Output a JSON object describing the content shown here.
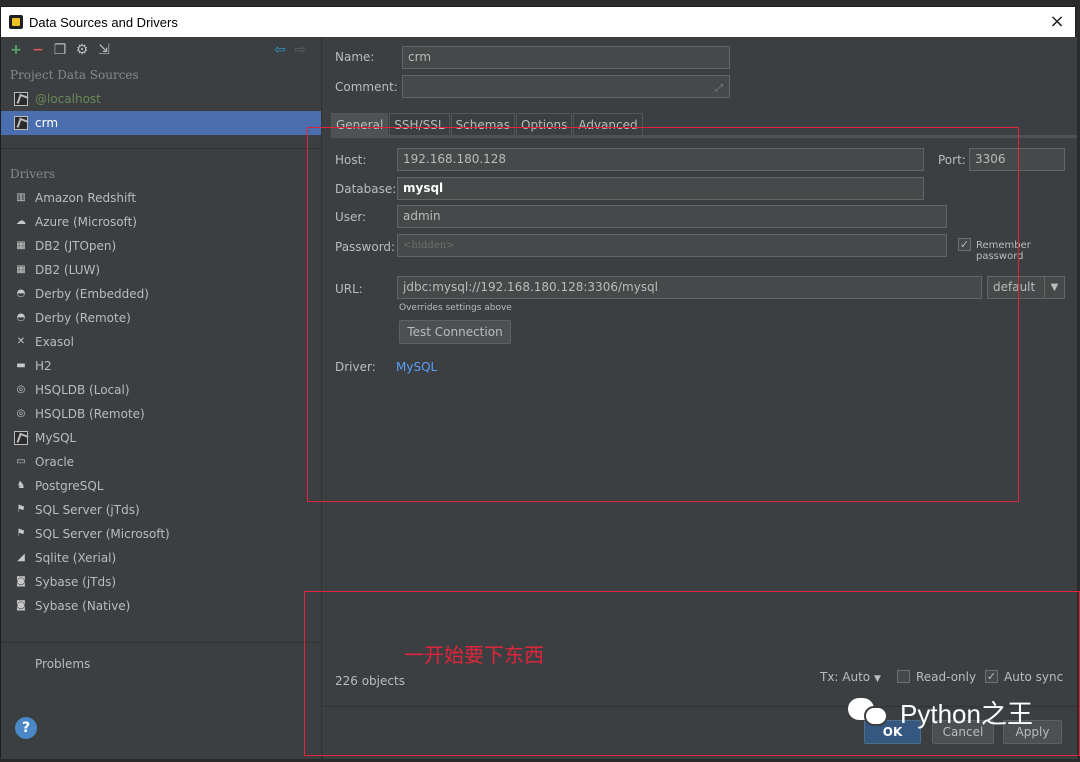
{
  "window": {
    "title": "Data Sources and Drivers",
    "close_glyph": "×"
  },
  "toolbar": {
    "add": "+",
    "remove": "−",
    "back": "⇦",
    "forward": "⇨"
  },
  "sidebar": {
    "project_title": "Project Data Sources",
    "datasources": [
      {
        "label": "@localhost"
      },
      {
        "label": "crm"
      }
    ],
    "drivers_title": "Drivers",
    "drivers": [
      {
        "label": "Amazon Redshift"
      },
      {
        "label": "Azure (Microsoft)"
      },
      {
        "label": "DB2 (JTOpen)"
      },
      {
        "label": "DB2 (LUW)"
      },
      {
        "label": "Derby (Embedded)"
      },
      {
        "label": "Derby (Remote)"
      },
      {
        "label": "Exasol"
      },
      {
        "label": "H2"
      },
      {
        "label": "HSQLDB (Local)"
      },
      {
        "label": "HSQLDB (Remote)"
      },
      {
        "label": "MySQL"
      },
      {
        "label": "Oracle"
      },
      {
        "label": "PostgreSQL"
      },
      {
        "label": "SQL Server (jTds)"
      },
      {
        "label": "SQL Server (Microsoft)"
      },
      {
        "label": "Sqlite (Xerial)"
      },
      {
        "label": "Sybase (jTds)"
      },
      {
        "label": "Sybase (Native)"
      }
    ],
    "problems": "Problems",
    "help": "?"
  },
  "form": {
    "name_label": "Name:",
    "name_value": "crm",
    "comment_label": "Comment:",
    "comment_value": "",
    "tabs": [
      {
        "label": "General"
      },
      {
        "label": "SSH/SSL"
      },
      {
        "label": "Schemas"
      },
      {
        "label": "Options"
      },
      {
        "label": "Advanced"
      }
    ],
    "host_label": "Host:",
    "host_value": "192.168.180.128",
    "port_label": "Port:",
    "port_value": "3306",
    "database_label": "Database:",
    "database_value": "mysql",
    "user_label": "User:",
    "user_value": "admin",
    "password_label": "Password:",
    "password_placeholder": "<hidden>",
    "remember_password": "Remember password",
    "url_label": "URL:",
    "url_value": "jdbc:mysql://192.168.180.128:3306/mysql",
    "url_mode": "default",
    "url_hint": "Overrides settings above",
    "test_connection": "Test Connection",
    "driver_label": "Driver:",
    "driver_value": "MySQL"
  },
  "footer": {
    "objects_count": "226 objects",
    "tx_mode": "Tx: Auto",
    "read_only": "Read-only",
    "auto_sync": "Auto sync",
    "ok": "OK",
    "cancel": "Cancel",
    "apply": "Apply"
  },
  "annotation": {
    "text": "一开始要下东西",
    "color": "#e0243b"
  },
  "watermark": {
    "text": "Python之王"
  }
}
